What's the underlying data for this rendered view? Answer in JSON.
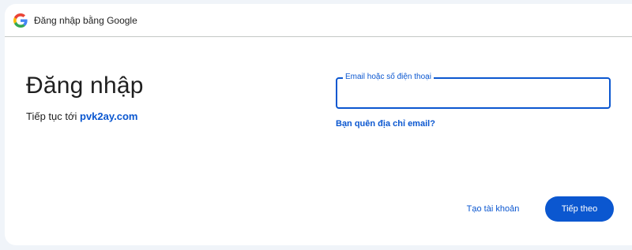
{
  "header": {
    "title": "Đăng nhập bằng Google",
    "logo_icon": "google-g-icon"
  },
  "main": {
    "title": "Đăng nhập",
    "subtitle_prefix": "Tiếp tục tới ",
    "subtitle_domain": "pvk2ay.com"
  },
  "email_field": {
    "label": "Email hoặc số điện thoại",
    "value": ""
  },
  "forgot_email_link": "Bạn quên địa chỉ email?",
  "actions": {
    "create_account_label": "Tạo tài khoản",
    "next_label": "Tiếp theo"
  },
  "colors": {
    "accent": "#0b57d0",
    "page_background": "#f0f4f9",
    "card_background": "#ffffff",
    "divider": "#c4c7c5"
  }
}
